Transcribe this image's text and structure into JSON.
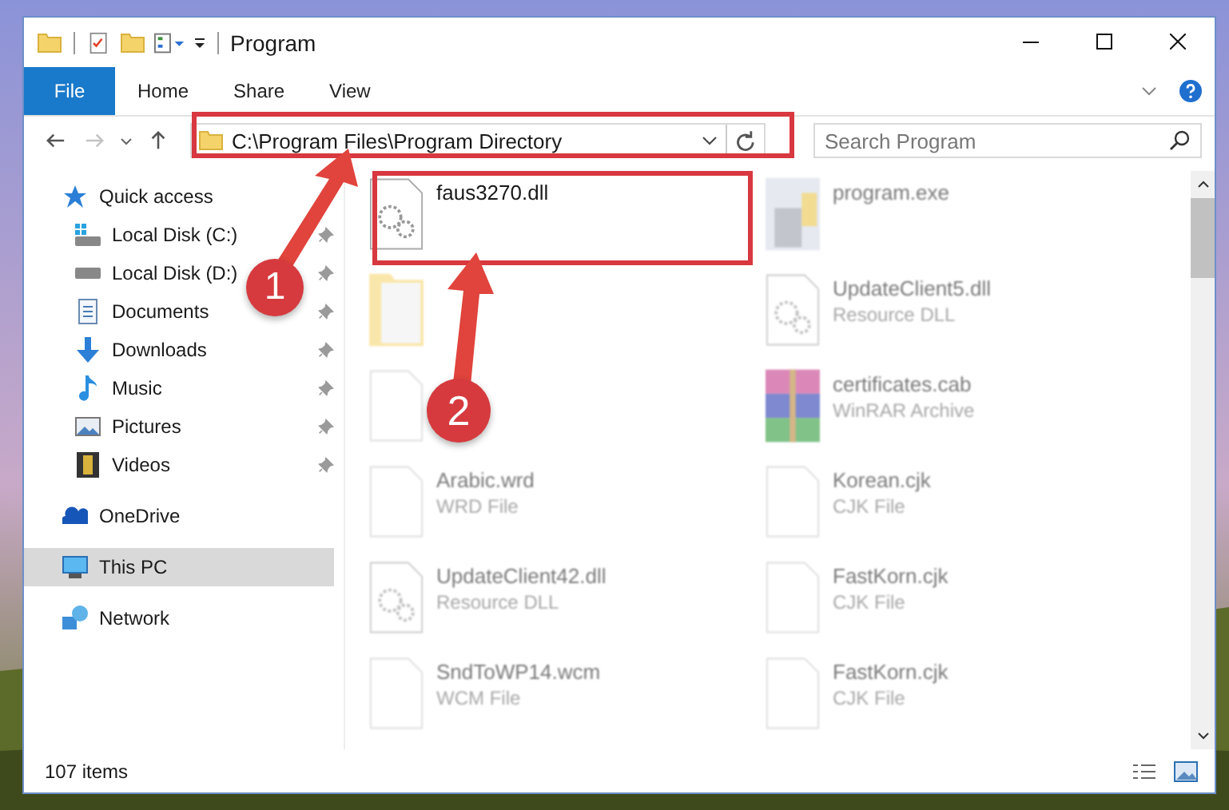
{
  "window": {
    "title": "Program"
  },
  "ribbon_tabs": [
    {
      "label": "File",
      "kind": "file"
    },
    {
      "label": "Home",
      "kind": "tab"
    },
    {
      "label": "Share",
      "kind": "tab"
    },
    {
      "label": "View",
      "kind": "tab"
    }
  ],
  "address": {
    "path": "C:\\Program Files\\Program Directory"
  },
  "search": {
    "placeholder": "Search Program"
  },
  "sidebar": {
    "items": [
      {
        "label": "Quick access",
        "selected": false,
        "children": [
          {
            "label": "Local Disk (C:)",
            "pinned": true
          },
          {
            "label": "Local Disk (D:)",
            "pinned": true
          },
          {
            "label": "Documents",
            "pinned": true
          },
          {
            "label": "Downloads",
            "pinned": true
          },
          {
            "label": "Music",
            "pinned": true
          },
          {
            "label": "Pictures",
            "pinned": true
          },
          {
            "label": "Videos",
            "pinned": true
          }
        ]
      },
      {
        "label": "OneDrive",
        "selected": false
      },
      {
        "label": "This PC",
        "selected": true
      },
      {
        "label": "Network",
        "selected": false
      }
    ]
  },
  "files": [
    {
      "name": "faus3270.dll",
      "blurred": false
    },
    {
      "name": "program.exe",
      "blurred": true
    },
    {
      "blurred": true
    },
    {
      "name": "UpdateClient5.dll",
      "type": "Resource DLL",
      "blurred": true
    },
    {
      "blurred": true
    },
    {
      "name": "certificates.cab",
      "type": "WinRAR Archive",
      "blurred": true
    },
    {
      "name": "Arabic.wrd",
      "type": "WRD File",
      "blurred": true
    },
    {
      "name": "Korean.cjk",
      "type": "CJK File",
      "blurred": true
    },
    {
      "name": "UpdateClient42.dll",
      "type": "Resource DLL",
      "blurred": true
    },
    {
      "name": "FastKorn.cjk",
      "type": "CJK File",
      "blurred": true
    },
    {
      "name": "SndToWP14.wcm",
      "type": "WCM File",
      "blurred": true
    },
    {
      "name": "FastKorn.cjk",
      "type": "CJK File",
      "blurred": true
    }
  ],
  "status_bar": {
    "count": "107 items"
  },
  "callouts": [
    {
      "number": "1"
    },
    {
      "number": "2"
    }
  ]
}
